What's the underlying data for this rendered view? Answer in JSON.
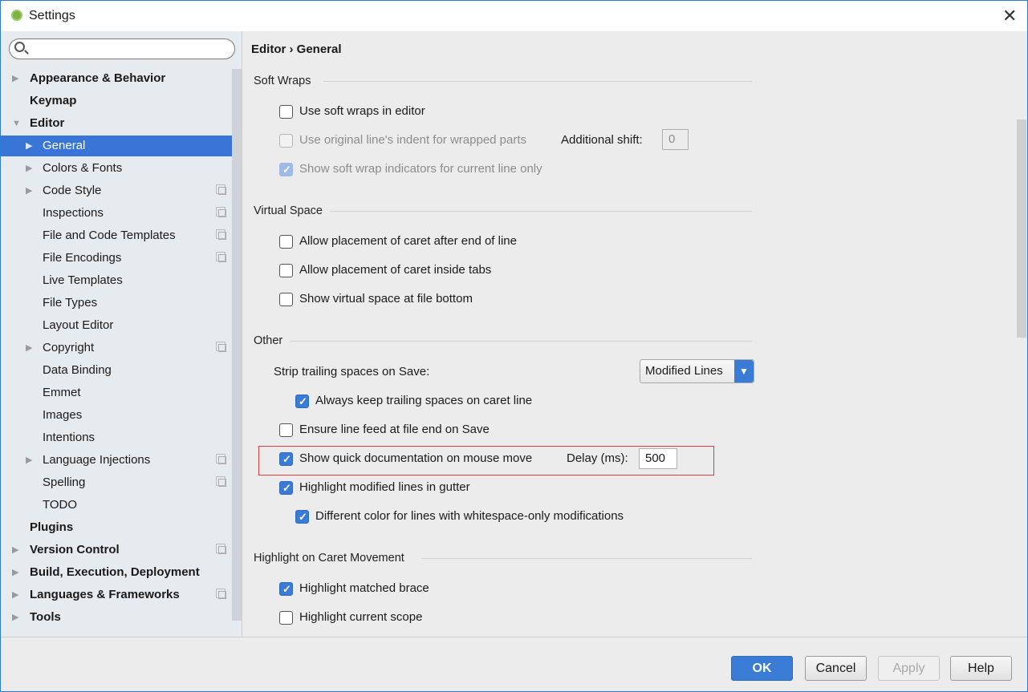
{
  "window": {
    "title": "Settings"
  },
  "search": {
    "placeholder": ""
  },
  "sidebar": {
    "items": [
      {
        "label": "Appearance & Behavior",
        "level": 0,
        "arrow": "right",
        "copy": false
      },
      {
        "label": "Keymap",
        "level": 0,
        "arrow": "none",
        "copy": false
      },
      {
        "label": "Editor",
        "level": 0,
        "arrow": "down",
        "copy": false
      },
      {
        "label": "General",
        "level": 1,
        "arrow": "right",
        "copy": false,
        "selected": true
      },
      {
        "label": "Colors & Fonts",
        "level": 1,
        "arrow": "right",
        "copy": false
      },
      {
        "label": "Code Style",
        "level": 1,
        "arrow": "right",
        "copy": true
      },
      {
        "label": "Inspections",
        "level": 1,
        "arrow": "none",
        "copy": true
      },
      {
        "label": "File and Code Templates",
        "level": 1,
        "arrow": "none",
        "copy": true
      },
      {
        "label": "File Encodings",
        "level": 1,
        "arrow": "none",
        "copy": true
      },
      {
        "label": "Live Templates",
        "level": 1,
        "arrow": "none",
        "copy": false
      },
      {
        "label": "File Types",
        "level": 1,
        "arrow": "none",
        "copy": false
      },
      {
        "label": "Layout Editor",
        "level": 1,
        "arrow": "none",
        "copy": false
      },
      {
        "label": "Copyright",
        "level": 1,
        "arrow": "right",
        "copy": true
      },
      {
        "label": "Data Binding",
        "level": 1,
        "arrow": "none",
        "copy": false
      },
      {
        "label": "Emmet",
        "level": 1,
        "arrow": "none",
        "copy": false
      },
      {
        "label": "Images",
        "level": 1,
        "arrow": "none",
        "copy": false
      },
      {
        "label": "Intentions",
        "level": 1,
        "arrow": "none",
        "copy": false
      },
      {
        "label": "Language Injections",
        "level": 1,
        "arrow": "right",
        "copy": true
      },
      {
        "label": "Spelling",
        "level": 1,
        "arrow": "none",
        "copy": true
      },
      {
        "label": "TODO",
        "level": 1,
        "arrow": "none",
        "copy": false
      },
      {
        "label": "Plugins",
        "level": 0,
        "arrow": "none",
        "copy": false
      },
      {
        "label": "Version Control",
        "level": 0,
        "arrow": "right",
        "copy": true
      },
      {
        "label": "Build, Execution, Deployment",
        "level": 0,
        "arrow": "right",
        "copy": false
      },
      {
        "label": "Languages & Frameworks",
        "level": 0,
        "arrow": "right",
        "copy": true
      },
      {
        "label": "Tools",
        "level": 0,
        "arrow": "right",
        "copy": false
      }
    ]
  },
  "main": {
    "breadcrumb": "Editor › General",
    "soft_wraps": {
      "header": "Soft Wraps",
      "use_soft_wraps": "Use soft wraps in editor",
      "original_indent": "Use original line's indent for wrapped parts",
      "additional_shift_label": "Additional shift:",
      "additional_shift_value": "0",
      "show_indicators": "Show soft wrap indicators for current line only"
    },
    "virtual_space": {
      "header": "Virtual Space",
      "after_end": "Allow placement of caret after end of line",
      "inside_tabs": "Allow placement of caret inside tabs",
      "file_bottom": "Show virtual space at file bottom"
    },
    "other": {
      "header": "Other",
      "strip_label": "Strip trailing spaces on Save:",
      "strip_value": "Modified Lines",
      "keep_caret": "Always keep trailing spaces on caret line",
      "line_feed": "Ensure line feed at file end on Save",
      "quick_doc": "Show quick documentation on mouse move",
      "delay_label": "Delay (ms):",
      "delay_value": "500",
      "highlight_modified": "Highlight modified lines in gutter",
      "whitespace_color": "Different color for lines with whitespace-only modifications"
    },
    "caret": {
      "header": "Highlight on Caret Movement",
      "matched_brace": "Highlight matched brace",
      "current_scope": "Highlight current scope"
    }
  },
  "footer": {
    "ok": "OK",
    "cancel": "Cancel",
    "apply": "Apply",
    "help": "Help"
  },
  "colors": {
    "accent": "#3875d7",
    "highlight_box": "#e03c3c"
  }
}
